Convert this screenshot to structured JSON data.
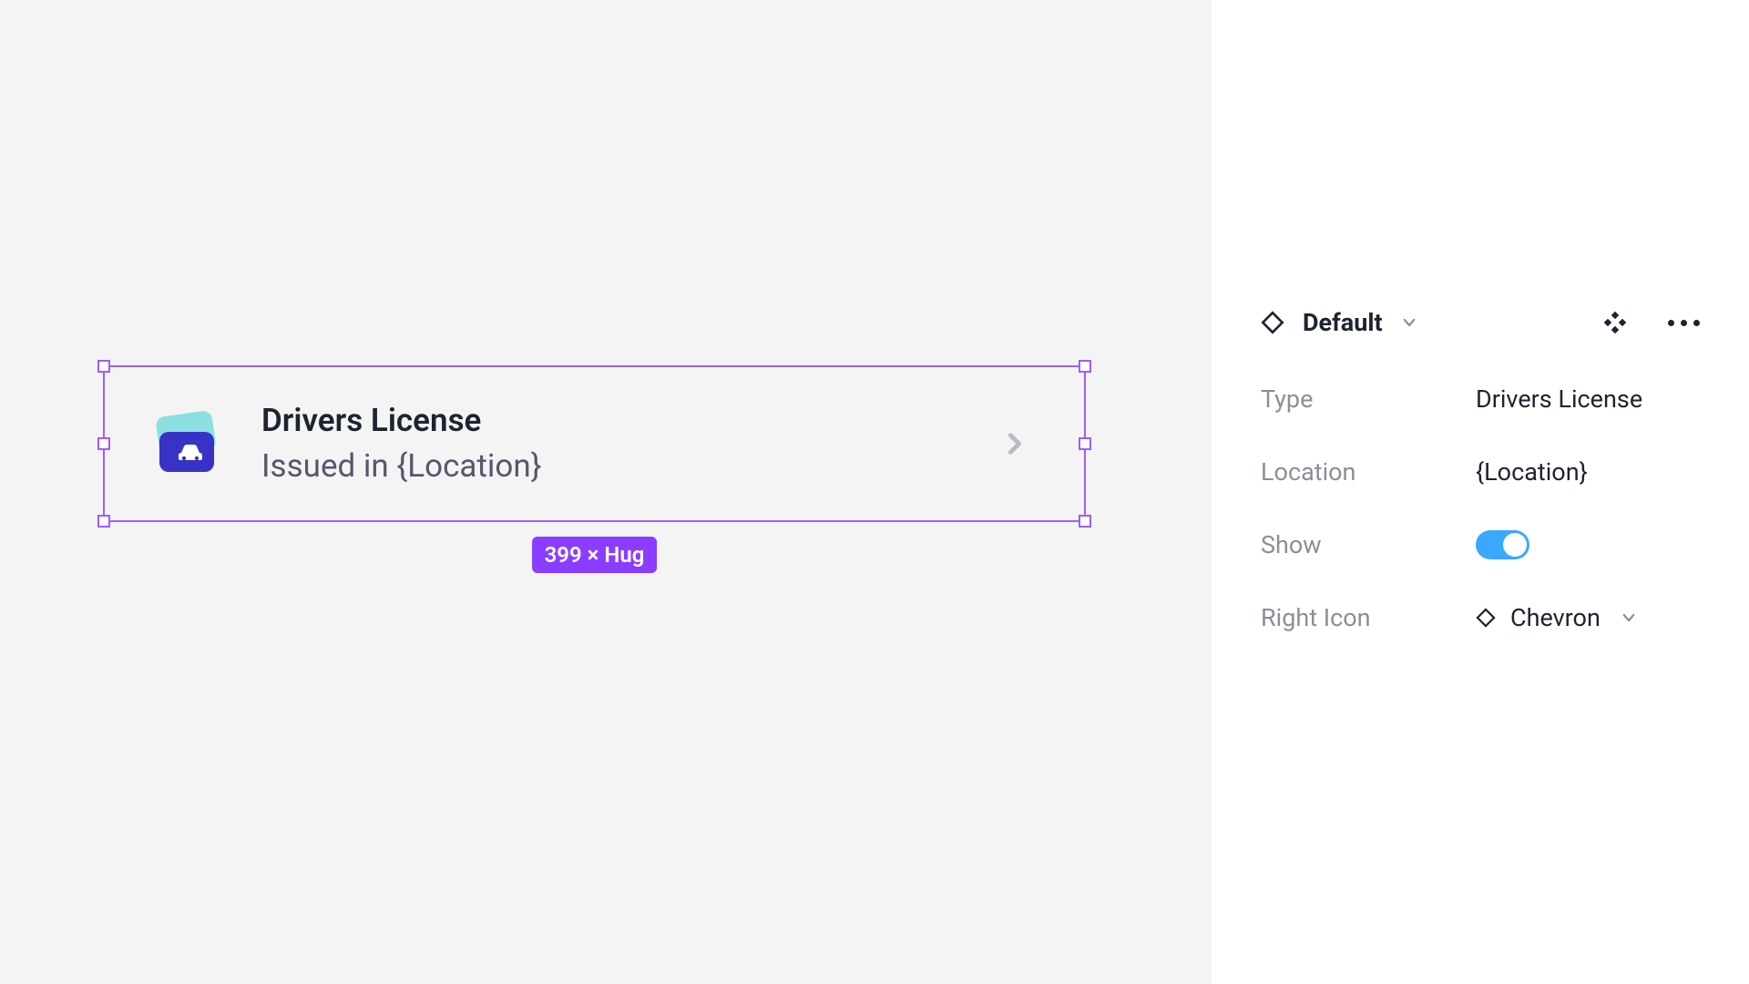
{
  "canvas": {
    "card": {
      "title": "Drivers License",
      "subtitle": "Issued in {Location}"
    },
    "size_label": "399 × Hug"
  },
  "inspector": {
    "variant_name": "Default",
    "props": {
      "type": {
        "label": "Type",
        "value": "Drivers License"
      },
      "location": {
        "label": "Location",
        "value": "{Location}"
      },
      "show": {
        "label": "Show",
        "on": true
      },
      "right_icon": {
        "label": "Right Icon",
        "value": "Chevron"
      }
    }
  }
}
